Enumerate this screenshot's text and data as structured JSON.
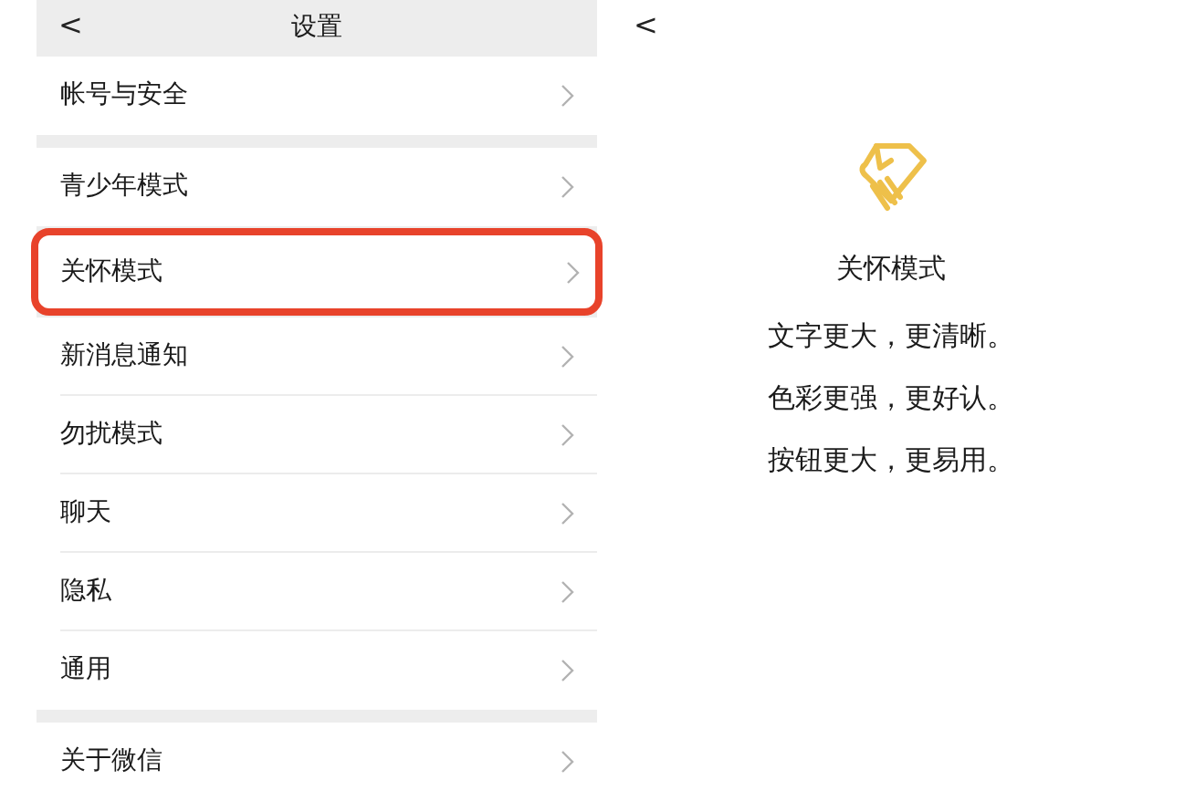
{
  "settings": {
    "title": "设置",
    "back": "<",
    "groups": [
      {
        "items": [
          {
            "label": "帐号与安全",
            "highlighted": false
          }
        ]
      },
      {
        "items": [
          {
            "label": "青少年模式",
            "highlighted": false
          },
          {
            "label": "关怀模式",
            "highlighted": true
          },
          {
            "label": "新消息通知",
            "highlighted": false
          },
          {
            "label": "勿扰模式",
            "highlighted": false
          },
          {
            "label": "聊天",
            "highlighted": false
          },
          {
            "label": "隐私",
            "highlighted": false
          },
          {
            "label": "通用",
            "highlighted": false
          }
        ]
      },
      {
        "items": [
          {
            "label": "关于微信",
            "highlighted": false
          }
        ]
      }
    ]
  },
  "care_mode": {
    "back": "<",
    "title": "关怀模式",
    "lines": [
      "文字更大，更清晰。",
      "色彩更强，更好认。",
      "按钮更大，更易用。"
    ]
  }
}
